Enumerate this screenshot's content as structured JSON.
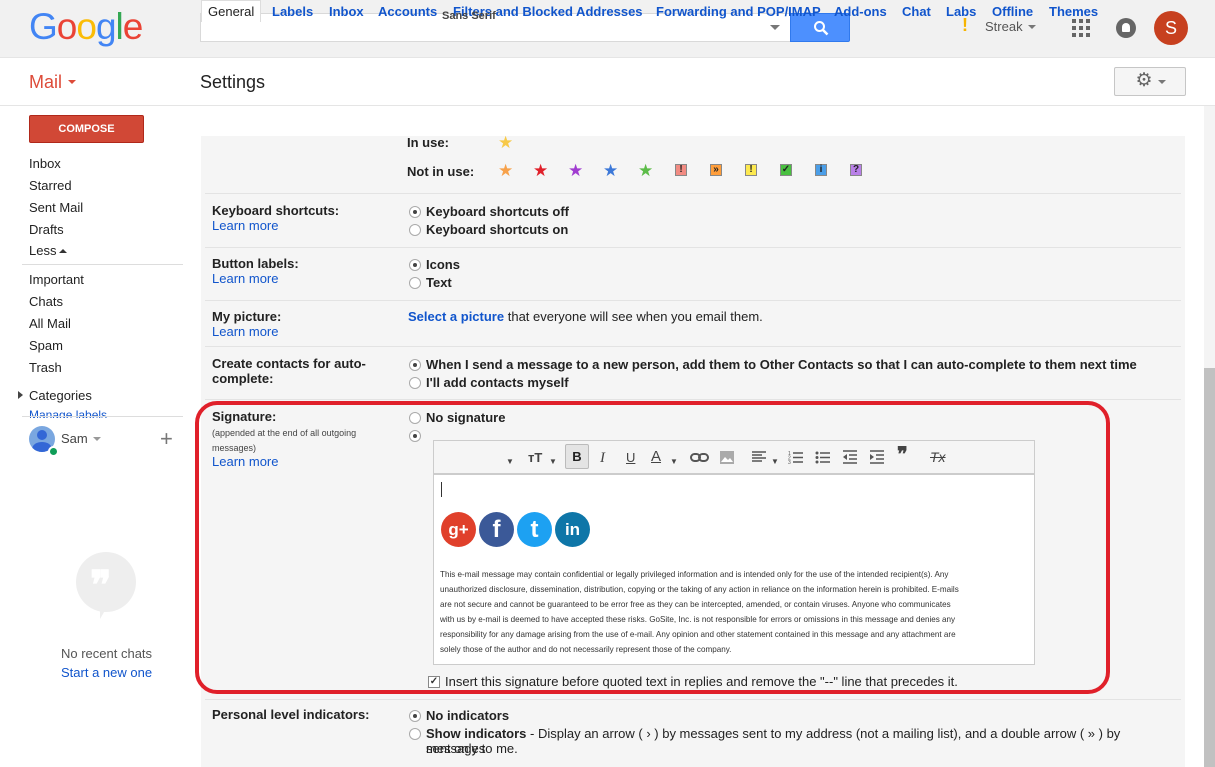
{
  "header": {
    "logo": [
      "G",
      "o",
      "o",
      "g",
      "l",
      "e"
    ],
    "logo_colors": [
      "#4285f4",
      "#ea4335",
      "#fbbc05",
      "#4285f4",
      "#34a853",
      "#ea4335"
    ],
    "search_placeholder": "",
    "search_icon": "search-icon",
    "streak_label": "Streak",
    "streak_mark": "!",
    "avatar_initial": "S"
  },
  "subheader": {
    "app_label": "Mail",
    "page_title": "Settings",
    "gear_icon": "⚙"
  },
  "sidebar": {
    "compose_label": "COMPOSE",
    "items": [
      "Inbox",
      "Starred",
      "Sent Mail",
      "Drafts",
      "Less"
    ],
    "items2": [
      "Important",
      "Chats",
      "All Mail",
      "Spam",
      "Trash"
    ],
    "categories_label": "Categories",
    "manage_labels": "Manage labels",
    "chat_user": "Sam",
    "add_icon": "+",
    "no_chats": "No recent chats",
    "start_new": "Start a new one"
  },
  "tabs": [
    "General",
    "Labels",
    "Inbox",
    "Accounts",
    "Filters and Blocked Addresses",
    "Forwarding and POP/IMAP",
    "Add-ons",
    "Chat",
    "Labs",
    "Offline",
    "Themes"
  ],
  "stars": {
    "in_use_label": "In use:",
    "not_in_use_label": "Not in use:",
    "star_colors": [
      "#f7a14a",
      "#e0202a",
      "#a03cd0",
      "#3c78d8",
      "#5cbc48"
    ],
    "square_marks": [
      "!",
      "»",
      "!",
      "✓",
      "i",
      "?"
    ],
    "square_colors": [
      "#f28b82",
      "#ff9e3b",
      "#fde94f",
      "#49c040",
      "#4a9ee8",
      "#b980e8"
    ]
  },
  "settings": {
    "keyboard": {
      "label": "Keyboard shortcuts:",
      "learn_more": "Learn more",
      "options": [
        "Keyboard shortcuts off",
        "Keyboard shortcuts on"
      ]
    },
    "buttons": {
      "label": "Button labels:",
      "learn_more": "Learn more",
      "options": [
        "Icons",
        "Text"
      ]
    },
    "picture": {
      "label": "My picture:",
      "learn_more": "Learn more",
      "link": "Select a picture",
      "text": " that everyone will see when you email them."
    },
    "contacts": {
      "label_line1": "Create contacts for auto-",
      "label_line2": "complete:",
      "options": [
        "When I send a message to a new person, add them to Other Contacts so that I can auto-complete to them next time",
        "I'll add contacts myself"
      ]
    },
    "signature": {
      "label": "Signature:",
      "sub1": "(appended at the end of all outgoing",
      "sub2": "messages)",
      "learn_more": "Learn more",
      "option_none": "No signature",
      "toolbar_font": "Sans Serif",
      "bold_label": "B",
      "social": [
        {
          "name": "google-plus",
          "text": "g+",
          "color": "#e0402b"
        },
        {
          "name": "facebook",
          "text": "f",
          "color": "#3b5998"
        },
        {
          "name": "twitter",
          "text": "t",
          "color": "#1da1f2"
        },
        {
          "name": "linkedin",
          "text": "in",
          "color": "#0e76a8"
        }
      ],
      "disclaimer": [
        "This e-mail message may contain confidential or legally privileged information and is intended only for the use of the intended recipient(s). Any",
        "unauthorized disclosure, dissemination, distribution, copying or the taking of any action in reliance on the information herein is prohibited. E-mails",
        "are not secure and cannot be guaranteed to be error free as they can be intercepted, amended, or contain viruses. Anyone who communicates",
        "with us by e-mail is deemed to have accepted these risks. GoSite, Inc. is not responsible for errors or omissions in this message and denies any",
        "responsibility for any damage arising from the use of e-mail. Any opinion and other statement contained in this message and any attachment are",
        "solely those of the author and do not necessarily represent those of the company."
      ],
      "insert_before": "Insert this signature before quoted text in replies and remove the \"--\" line that precedes it."
    },
    "personal": {
      "label": "Personal level indicators:",
      "option_none": "No indicators",
      "option_show": "Show indicators",
      "show_text": " - Display an arrow ( › ) by messages sent to my address (not a mailing list), and a double arrow ( » ) by messages",
      "show_text2": "sent only to me."
    }
  }
}
